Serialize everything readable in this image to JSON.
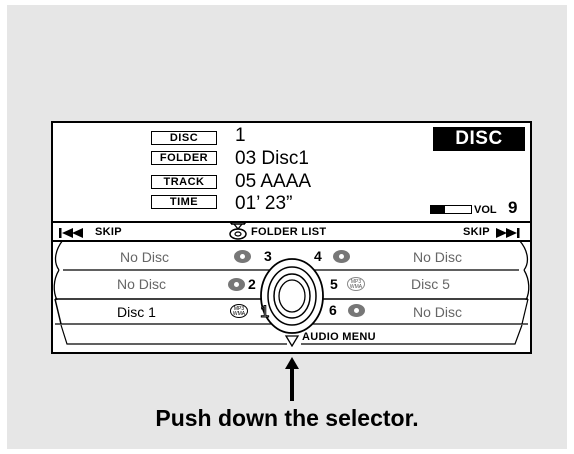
{
  "display": {
    "labels": {
      "disc": "DISC",
      "folder": "FOLDER",
      "track": "TRACK",
      "time": "TIME"
    },
    "values": {
      "disc": "1",
      "folder": "03 Disc1",
      "track": "05 AAAA",
      "time": "01’ 23”"
    },
    "mode_badge": "DISC",
    "volume": {
      "label": "VOL",
      "value": "9",
      "level_fraction": 0.35
    }
  },
  "controls": {
    "skip_back": "SKIP",
    "skip_back_icon": "skip-back-icon",
    "folder_list": "FOLDER LIST",
    "skip_fwd": "SKIP",
    "skip_fwd_icon": "skip-forward-icon",
    "audio_menu": "AUDIO MENU"
  },
  "discs": {
    "left": [
      {
        "label": "No Disc",
        "number": "3"
      },
      {
        "label": "No Disc",
        "number": "2"
      },
      {
        "label": "Disc 1",
        "number": "1"
      }
    ],
    "right": [
      {
        "label": "No Disc",
        "number": "4"
      },
      {
        "label": "Disc 5",
        "number": "5"
      },
      {
        "label": "No Disc",
        "number": "6"
      }
    ],
    "mp3_badge": "MP3\nWMA"
  },
  "caption": "Push down the selector."
}
